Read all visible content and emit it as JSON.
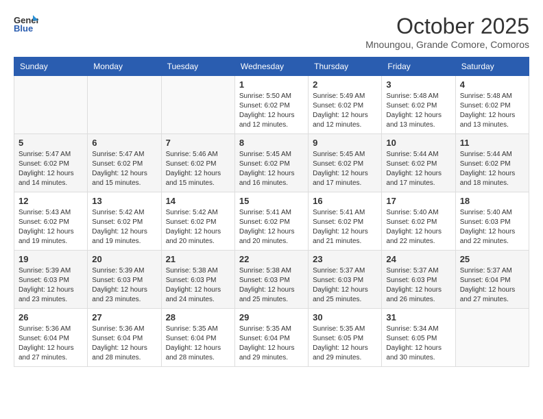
{
  "header": {
    "logo_general": "General",
    "logo_blue": "Blue",
    "month_title": "October 2025",
    "location": "Mnoungou, Grande Comore, Comoros"
  },
  "days_of_week": [
    "Sunday",
    "Monday",
    "Tuesday",
    "Wednesday",
    "Thursday",
    "Friday",
    "Saturday"
  ],
  "weeks": [
    [
      {
        "day": "",
        "info": ""
      },
      {
        "day": "",
        "info": ""
      },
      {
        "day": "",
        "info": ""
      },
      {
        "day": "1",
        "info": "Sunrise: 5:50 AM\nSunset: 6:02 PM\nDaylight: 12 hours and 12 minutes."
      },
      {
        "day": "2",
        "info": "Sunrise: 5:49 AM\nSunset: 6:02 PM\nDaylight: 12 hours and 12 minutes."
      },
      {
        "day": "3",
        "info": "Sunrise: 5:48 AM\nSunset: 6:02 PM\nDaylight: 12 hours and 13 minutes."
      },
      {
        "day": "4",
        "info": "Sunrise: 5:48 AM\nSunset: 6:02 PM\nDaylight: 12 hours and 13 minutes."
      }
    ],
    [
      {
        "day": "5",
        "info": "Sunrise: 5:47 AM\nSunset: 6:02 PM\nDaylight: 12 hours and 14 minutes."
      },
      {
        "day": "6",
        "info": "Sunrise: 5:47 AM\nSunset: 6:02 PM\nDaylight: 12 hours and 15 minutes."
      },
      {
        "day": "7",
        "info": "Sunrise: 5:46 AM\nSunset: 6:02 PM\nDaylight: 12 hours and 15 minutes."
      },
      {
        "day": "8",
        "info": "Sunrise: 5:45 AM\nSunset: 6:02 PM\nDaylight: 12 hours and 16 minutes."
      },
      {
        "day": "9",
        "info": "Sunrise: 5:45 AM\nSunset: 6:02 PM\nDaylight: 12 hours and 17 minutes."
      },
      {
        "day": "10",
        "info": "Sunrise: 5:44 AM\nSunset: 6:02 PM\nDaylight: 12 hours and 17 minutes."
      },
      {
        "day": "11",
        "info": "Sunrise: 5:44 AM\nSunset: 6:02 PM\nDaylight: 12 hours and 18 minutes."
      }
    ],
    [
      {
        "day": "12",
        "info": "Sunrise: 5:43 AM\nSunset: 6:02 PM\nDaylight: 12 hours and 19 minutes."
      },
      {
        "day": "13",
        "info": "Sunrise: 5:42 AM\nSunset: 6:02 PM\nDaylight: 12 hours and 19 minutes."
      },
      {
        "day": "14",
        "info": "Sunrise: 5:42 AM\nSunset: 6:02 PM\nDaylight: 12 hours and 20 minutes."
      },
      {
        "day": "15",
        "info": "Sunrise: 5:41 AM\nSunset: 6:02 PM\nDaylight: 12 hours and 20 minutes."
      },
      {
        "day": "16",
        "info": "Sunrise: 5:41 AM\nSunset: 6:02 PM\nDaylight: 12 hours and 21 minutes."
      },
      {
        "day": "17",
        "info": "Sunrise: 5:40 AM\nSunset: 6:02 PM\nDaylight: 12 hours and 22 minutes."
      },
      {
        "day": "18",
        "info": "Sunrise: 5:40 AM\nSunset: 6:03 PM\nDaylight: 12 hours and 22 minutes."
      }
    ],
    [
      {
        "day": "19",
        "info": "Sunrise: 5:39 AM\nSunset: 6:03 PM\nDaylight: 12 hours and 23 minutes."
      },
      {
        "day": "20",
        "info": "Sunrise: 5:39 AM\nSunset: 6:03 PM\nDaylight: 12 hours and 23 minutes."
      },
      {
        "day": "21",
        "info": "Sunrise: 5:38 AM\nSunset: 6:03 PM\nDaylight: 12 hours and 24 minutes."
      },
      {
        "day": "22",
        "info": "Sunrise: 5:38 AM\nSunset: 6:03 PM\nDaylight: 12 hours and 25 minutes."
      },
      {
        "day": "23",
        "info": "Sunrise: 5:37 AM\nSunset: 6:03 PM\nDaylight: 12 hours and 25 minutes."
      },
      {
        "day": "24",
        "info": "Sunrise: 5:37 AM\nSunset: 6:03 PM\nDaylight: 12 hours and 26 minutes."
      },
      {
        "day": "25",
        "info": "Sunrise: 5:37 AM\nSunset: 6:04 PM\nDaylight: 12 hours and 27 minutes."
      }
    ],
    [
      {
        "day": "26",
        "info": "Sunrise: 5:36 AM\nSunset: 6:04 PM\nDaylight: 12 hours and 27 minutes."
      },
      {
        "day": "27",
        "info": "Sunrise: 5:36 AM\nSunset: 6:04 PM\nDaylight: 12 hours and 28 minutes."
      },
      {
        "day": "28",
        "info": "Sunrise: 5:35 AM\nSunset: 6:04 PM\nDaylight: 12 hours and 28 minutes."
      },
      {
        "day": "29",
        "info": "Sunrise: 5:35 AM\nSunset: 6:04 PM\nDaylight: 12 hours and 29 minutes."
      },
      {
        "day": "30",
        "info": "Sunrise: 5:35 AM\nSunset: 6:05 PM\nDaylight: 12 hours and 29 minutes."
      },
      {
        "day": "31",
        "info": "Sunrise: 5:34 AM\nSunset: 6:05 PM\nDaylight: 12 hours and 30 minutes."
      },
      {
        "day": "",
        "info": ""
      }
    ]
  ]
}
